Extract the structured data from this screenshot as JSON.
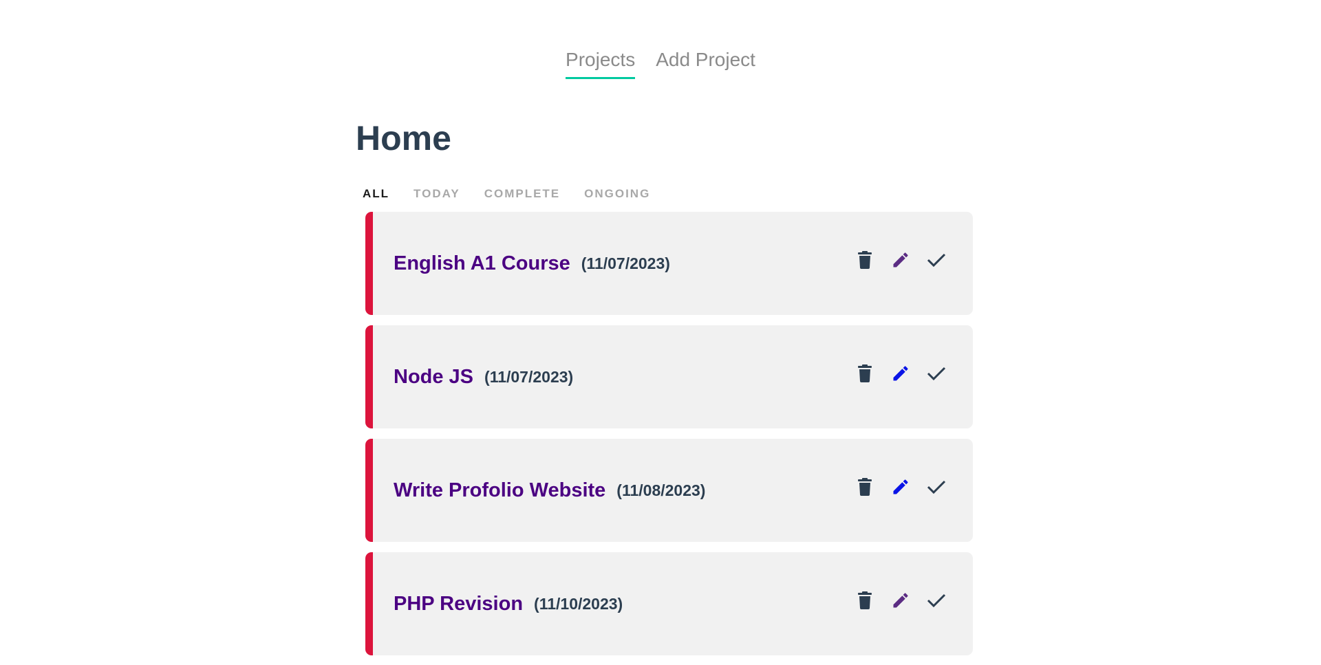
{
  "nav": {
    "projects_label": "Projects",
    "add_project_label": "Add Project",
    "active_underline_color": "#00c9a0"
  },
  "page": {
    "title": "Home"
  },
  "filters": [
    {
      "label": "ALL",
      "active": true
    },
    {
      "label": "TODAY",
      "active": false
    },
    {
      "label": "COMPLETE",
      "active": false
    },
    {
      "label": "ONGOING",
      "active": false
    }
  ],
  "colors": {
    "card_border": "#dc143c",
    "card_background": "#f1f1f1",
    "title_color": "#4b0082",
    "date_color": "#2c3e50",
    "edit_purple": "#5b2c83",
    "edit_blue": "#0a14e6"
  },
  "projects": [
    {
      "title": "English A1 Course",
      "date": "(11/07/2023)",
      "edit_icon_color": "#5b2c83"
    },
    {
      "title": "Node JS",
      "date": "(11/07/2023)",
      "edit_icon_color": "#0a14e6"
    },
    {
      "title": "Write Profolio Website",
      "date": "(11/08/2023)",
      "edit_icon_color": "#0a14e6"
    },
    {
      "title": "PHP Revision",
      "date": "(11/10/2023)",
      "edit_icon_color": "#5b2c83"
    }
  ],
  "icons": {
    "delete": "trash-icon",
    "edit": "pencil-icon",
    "complete": "check-icon"
  }
}
